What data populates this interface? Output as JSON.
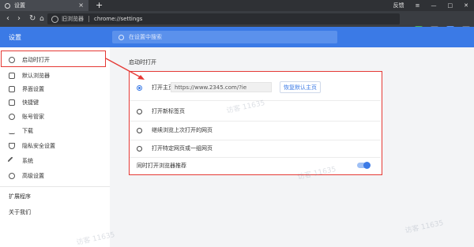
{
  "browser": {
    "tab_title": "设置",
    "new_tab": "+",
    "feedback": "反馈",
    "address_label": "旧浏览器",
    "address_url": "chrome://settings"
  },
  "settings": {
    "title": "设置",
    "search_placeholder": "在设置中搜索"
  },
  "sidebar": {
    "items": [
      {
        "label": "启动时打开",
        "icon": "power-icon"
      },
      {
        "label": "默认浏览器",
        "icon": "browser-icon"
      },
      {
        "label": "界面设置",
        "icon": "layout-icon"
      },
      {
        "label": "快捷键",
        "icon": "keyboard-icon"
      },
      {
        "label": "账号管家",
        "icon": "key-icon"
      },
      {
        "label": "下载",
        "icon": "download-icon"
      },
      {
        "label": "隐私安全设置",
        "icon": "shield-icon"
      },
      {
        "label": "系统",
        "icon": "wrench-icon"
      },
      {
        "label": "高级设置",
        "icon": "gear-icon"
      }
    ],
    "extensions": "扩展程序",
    "about": "关于我们"
  },
  "main": {
    "section_title": "启动时打开",
    "options": [
      {
        "label": "打开主页",
        "selected": true
      },
      {
        "label": "打开新标签页",
        "selected": false
      },
      {
        "label": "继续浏览上次打开的网页",
        "selected": false
      },
      {
        "label": "打开特定网页或一组网页",
        "selected": false
      }
    ],
    "homepage_url": "https://www.2345.com/?ie",
    "restore_button": "恢复默认主页",
    "toggle_label": "同时打开浏览器推荐",
    "toggle_on": true
  },
  "watermark": "访客 11635",
  "colors": {
    "accent": "#3b7ae6",
    "highlight": "#e53935"
  }
}
